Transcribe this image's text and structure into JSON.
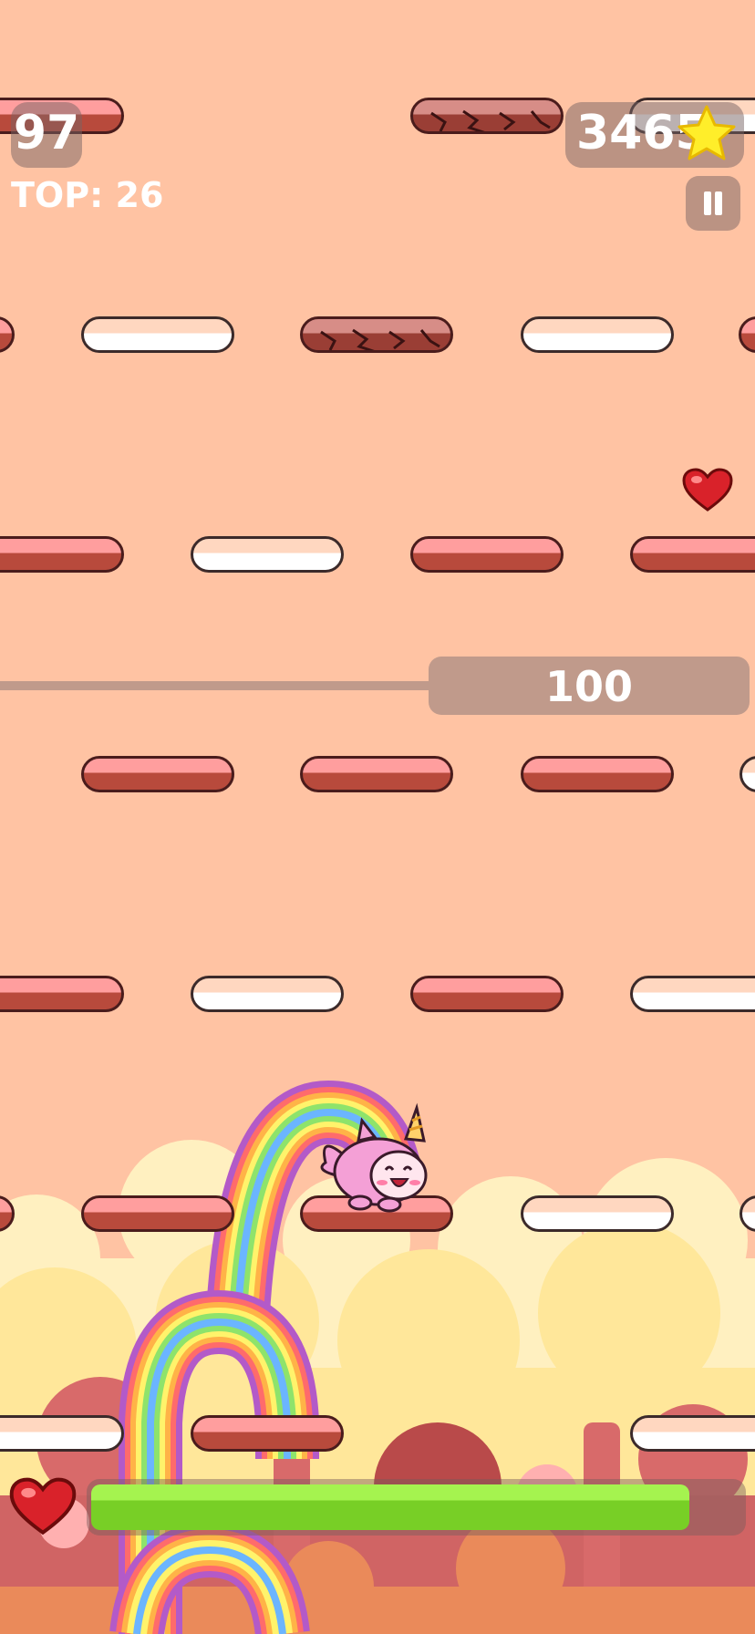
{
  "hud": {
    "height_score": "97",
    "top_score": "TOP: 26",
    "stars": "3465",
    "star_icon": "star-icon",
    "pause_icon": "pause-icon"
  },
  "milestone": {
    "label": "100"
  },
  "health": {
    "icon": "heart-icon",
    "level": 0.92,
    "color": "#8ee33b"
  },
  "pickup": {
    "icon": "heart-icon"
  },
  "player": {
    "character": "unicorn-cat-icon"
  },
  "colors": {
    "background": "#ffc3a3",
    "platform_pink": "#ff9e9e",
    "platform_cream": "#ffd7c0",
    "platform_cracked": "#9a3e35"
  }
}
